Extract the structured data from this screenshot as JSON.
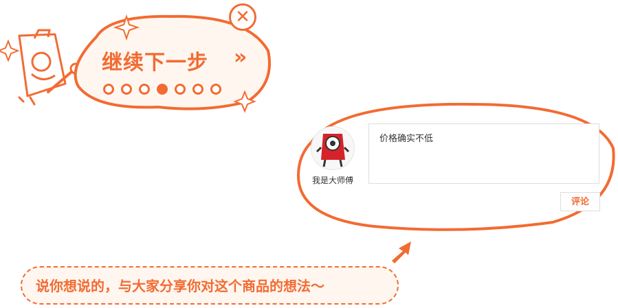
{
  "guide": {
    "next_label": "继续下一步",
    "next_arrows": "»",
    "close_symbol": "✕",
    "steps": [
      {
        "active": false
      },
      {
        "active": false
      },
      {
        "active": false
      },
      {
        "active": true
      },
      {
        "active": false
      },
      {
        "active": false
      },
      {
        "active": false
      }
    ]
  },
  "comment": {
    "username": "我是大师傅",
    "content": "价格确实不低",
    "submit_label": "评论"
  },
  "hint": {
    "text": "说你想说的，与大家分享你对这个商品的想法～"
  },
  "colors": {
    "accent": "#f26b32",
    "hint_bg": "#fff6ef",
    "border": "#dddddd"
  }
}
